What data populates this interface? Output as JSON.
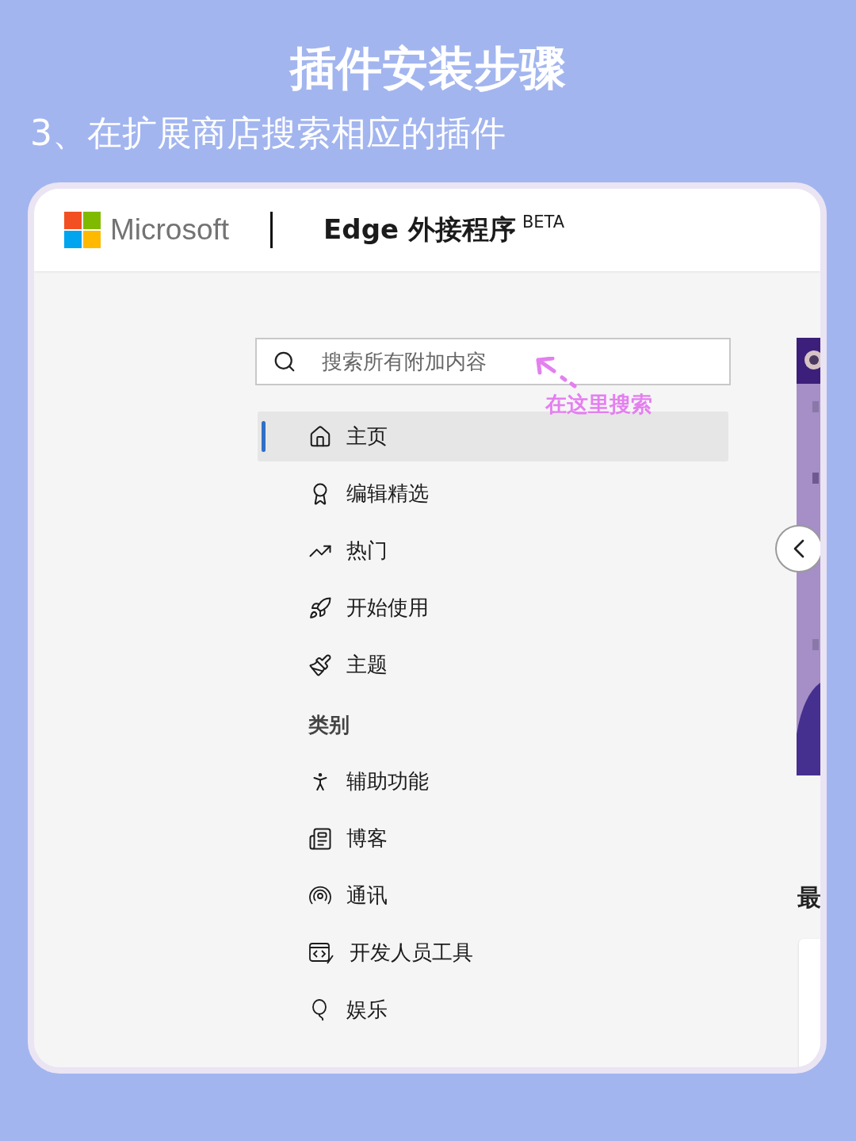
{
  "title": "插件安装步骤",
  "subtitle": "3、在扩展商店搜索相应的插件",
  "header": {
    "brand": "Microsoft",
    "product": "Edge 外接程序",
    "badge": "BETA"
  },
  "search": {
    "placeholder": "搜索所有附加内容"
  },
  "annotation": "在这里搜索",
  "nav": [
    {
      "label": "主页",
      "kind": "home",
      "selected": true
    },
    {
      "label": "编辑精选",
      "kind": "award",
      "selected": false
    },
    {
      "label": "热门",
      "kind": "trending",
      "selected": false
    },
    {
      "label": "开始使用",
      "kind": "rocket",
      "selected": false
    },
    {
      "label": "主题",
      "kind": "brush",
      "selected": false
    }
  ],
  "categories_heading": "类别",
  "categories": [
    {
      "label": "辅助功能",
      "kind": "accessibility"
    },
    {
      "label": "博客",
      "kind": "blog"
    },
    {
      "label": "通讯",
      "kind": "broadcast"
    },
    {
      "label": "开发人员工具",
      "kind": "devtools"
    },
    {
      "label": "娱乐",
      "kind": "balloon"
    }
  ],
  "side": {
    "heading": "最"
  }
}
